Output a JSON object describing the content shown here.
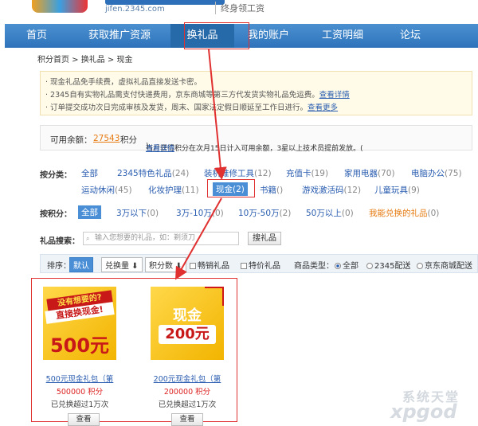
{
  "header": {
    "logo_url": "jifen.2345.com",
    "slogan": "终身领工资"
  },
  "nav": {
    "items": [
      "首页",
      "获取推广资源",
      "换礼品",
      "我的账户",
      "工资明细",
      "论坛"
    ],
    "active_index": 2
  },
  "breadcrumb": "积分首页 > 换礼品 > 现金",
  "notice": {
    "line1": "· 现金礼品免手续费，虚拟礼品直接发送卡密。",
    "line2": "· 2345自有实物礼品需支付快递费用，京东商城等第三方代发货实物礼品免运费。",
    "line2_link": "查看详情",
    "line3": "· 订单提交成功次日完成审核及发货，周末、国家法定假日顺延至工作日进行。",
    "line3_link": "查看更多"
  },
  "balance": {
    "label": "可用余额：",
    "value": "27543",
    "unit": "积分",
    "note": "当月获得积分在次月15日计入可用余额，3星以上技术员提前发放。(",
    "note_link": "查看详情",
    "note_end": ")"
  },
  "categories": {
    "label": "按分类：",
    "row1": [
      {
        "name": "全部",
        "count": ""
      },
      {
        "name": "2345特色礼品",
        "count": "(24)"
      },
      {
        "name": "装机维修工具",
        "count": "(12)"
      },
      {
        "name": "充值卡",
        "count": "(19)"
      },
      {
        "name": "家用电器",
        "count": "(70)"
      },
      {
        "name": "电脑办公",
        "count": "(75)"
      }
    ],
    "row2": [
      {
        "name": "运动休闲",
        "count": "(45)"
      },
      {
        "name": "化妆护理",
        "count": "(11)"
      },
      {
        "name": "现金",
        "count": "(2)"
      },
      {
        "name": "书籍",
        "count": "()"
      },
      {
        "name": "游戏激活码",
        "count": "(12)"
      },
      {
        "name": "儿童玩具",
        "count": "(9)"
      }
    ]
  },
  "points_filter": {
    "label": "按积分：",
    "items": [
      {
        "name": "全部",
        "count": ""
      },
      {
        "name": "3万以下",
        "count": "(0)"
      },
      {
        "name": "3万-10万",
        "count": "(0)"
      },
      {
        "name": "10万-50万",
        "count": "(2)"
      },
      {
        "name": "50万以上",
        "count": "(0)"
      },
      {
        "name": "我能兑换的礼品",
        "count": "(0)"
      }
    ]
  },
  "search": {
    "label": "礼品搜索：",
    "placeholder": "输入您想要的礼品，如：剃须刀",
    "button": "搜礼品"
  },
  "sortbar": {
    "label": "排序：",
    "default": "默认",
    "by_exchange": "兑换量 ⬇",
    "by_points": "积分数 ⬇",
    "hot": "畅销礼品",
    "special": "特价礼品",
    "type_label": "商品类型：",
    "type_all": "全部",
    "type_2345": "2345配送",
    "type_jd": "京东商城配送"
  },
  "products": [
    {
      "img_line1": "没有想要的?",
      "img_line2": "直接换现金!",
      "img_amount": "500元",
      "name": "500元现金礼包（第",
      "points": "500000 积分",
      "exchanged": "已兑换超过1万次",
      "button": "查看"
    },
    {
      "img_line1": "现金",
      "img_amount": "200元",
      "name": "200元现金礼包（第",
      "points": "200000 积分",
      "exchanged": "已兑换超过1万次",
      "button": "查看"
    }
  ],
  "watermark": {
    "line1": "系统天堂",
    "line2": "xpgod"
  },
  "colors": {
    "nav": "#3a82c7",
    "annotation": "#e03030",
    "link": "#2a5db0",
    "points": "#d22222"
  }
}
